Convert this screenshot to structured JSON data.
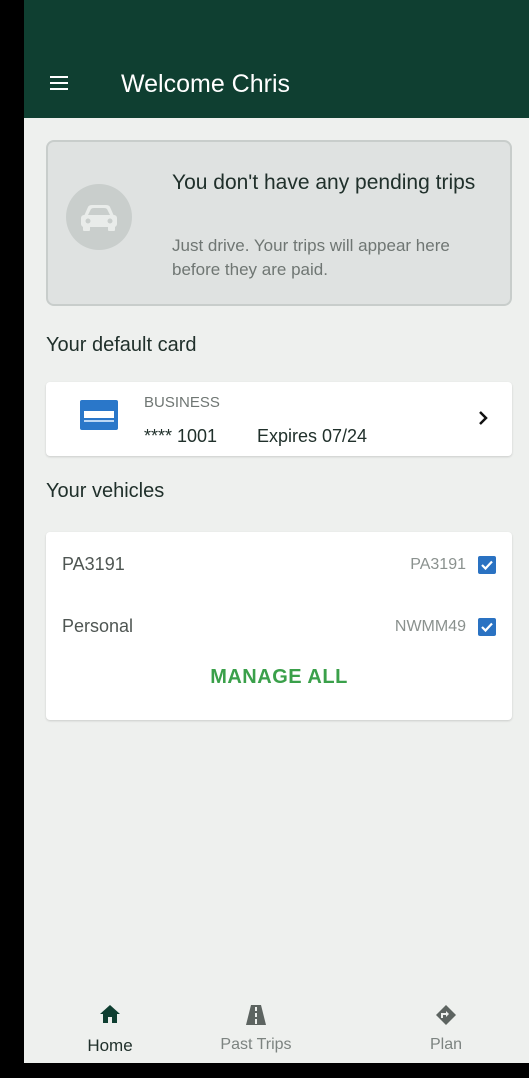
{
  "app_bar": {
    "title": "Welcome Chris",
    "menu_icon": "hamburger-menu-icon",
    "color": "#0f3f31"
  },
  "pending": {
    "title": "You don't have any pending trips",
    "subtitle": "Just drive. Your trips will appear here before they are paid.",
    "icon": "car-icon"
  },
  "default_card": {
    "section_label": "Your default card",
    "card_logo": "amex-card-icon",
    "card_type": "BUSINESS",
    "card_number": "**** 1001",
    "expiry": "Expires 07/24",
    "chevron": "chevron-right-icon"
  },
  "vehicles": {
    "section_label": "Your vehicles",
    "items": [
      {
        "name": "PA3191",
        "plate": "PA3191",
        "checked": true
      },
      {
        "name": "Personal",
        "plate": "NWMM49",
        "checked": true
      }
    ],
    "manage_label": "MANAGE ALL",
    "accent": "#3aa04a"
  },
  "bottom_nav": {
    "items": [
      {
        "label": "Home",
        "icon": "home-icon",
        "active": true
      },
      {
        "label": "Past Trips",
        "icon": "road-icon",
        "active": false
      },
      {
        "label": "Plan",
        "icon": "directions-icon",
        "active": false
      }
    ]
  }
}
